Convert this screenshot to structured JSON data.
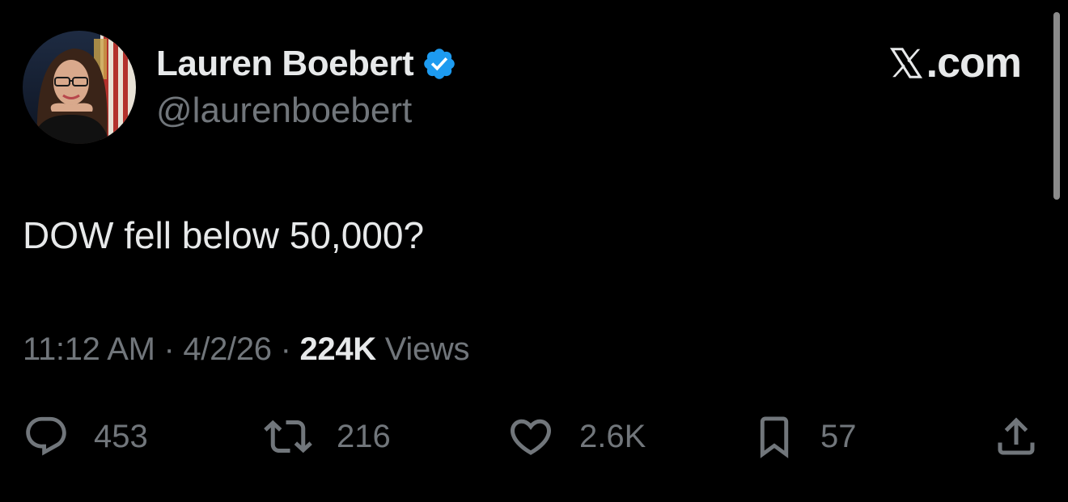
{
  "author": {
    "display_name": "Lauren Boebert",
    "handle": "@laurenboebert",
    "verified": true
  },
  "brand": {
    "name": "X.com",
    "suffix": ".com"
  },
  "tweet": {
    "text": "DOW fell below 50,000?"
  },
  "meta": {
    "time": "11:12 AM",
    "date": "4/2/26",
    "separator": "·",
    "views_count": "224K",
    "views_label": "Views"
  },
  "actions": {
    "replies": "453",
    "reposts": "216",
    "likes": "2.6K",
    "bookmarks": "57"
  },
  "colors": {
    "background": "#000000",
    "primary_text": "#e7e9ea",
    "secondary_text": "#71767b",
    "verified_badge": "#1d9bf0"
  },
  "icons": {
    "reply": "comment-bubble-icon",
    "repost": "repost-arrows-icon",
    "like": "heart-icon",
    "bookmark": "bookmark-icon",
    "share": "share-upload-icon",
    "verified": "verified-badge-icon",
    "brand": "x-logo-icon"
  }
}
